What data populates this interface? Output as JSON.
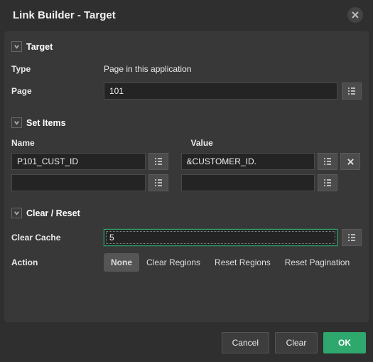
{
  "dialog": {
    "title": "Link Builder - Target"
  },
  "sections": {
    "target": {
      "title": "Target",
      "type_label": "Type",
      "type_value": "Page in this application",
      "page_label": "Page",
      "page_value": "101"
    },
    "set_items": {
      "title": "Set Items",
      "name_header": "Name",
      "value_header": "Value",
      "rows": [
        {
          "name": "P101_CUST_ID",
          "value": "&CUSTOMER_ID."
        },
        {
          "name": "",
          "value": ""
        }
      ]
    },
    "clear_reset": {
      "title": "Clear / Reset",
      "clear_cache_label": "Clear Cache",
      "clear_cache_value": "5",
      "action_label": "Action",
      "actions": {
        "none": "None",
        "clear_regions": "Clear Regions",
        "reset_regions": "Reset Regions",
        "reset_pagination": "Reset Pagination"
      },
      "action_selected": "none"
    }
  },
  "footer": {
    "cancel": "Cancel",
    "clear": "Clear",
    "ok": "OK"
  }
}
